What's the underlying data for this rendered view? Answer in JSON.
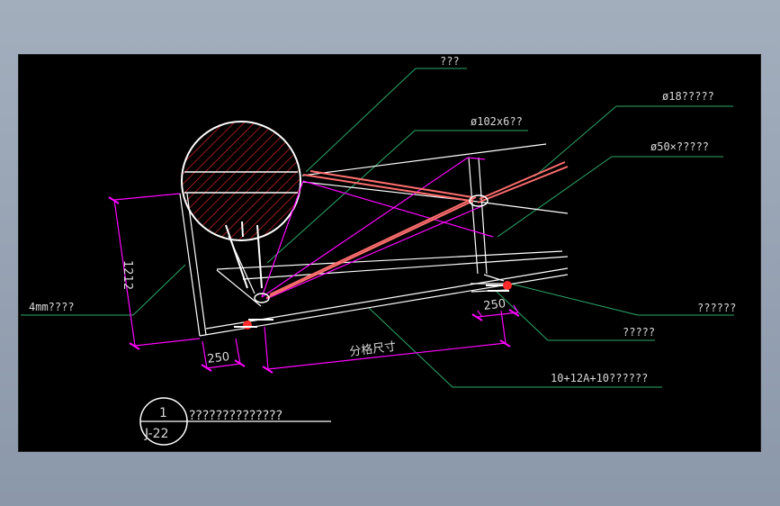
{
  "drawing": {
    "labels": {
      "top_label": "???",
      "rod_label": "ø18?????",
      "tube_label": "ø102x6??",
      "cable_label": "ø50×?????",
      "left_label": "4mm????",
      "right_top_label": "??????",
      "right_mid_label": "?????",
      "glass_label": "10+12A+10??????"
    },
    "dimensions": {
      "height": "1212",
      "left_offset": "250",
      "right_offset": "250",
      "grid_size": "分格尺寸"
    },
    "title_block": {
      "detail_number": "1",
      "sheet_ref": "J-22",
      "title": "??????????????"
    },
    "colors": {
      "background": "#000000",
      "window_bg": "#95a1b3",
      "white_line": "#ffffff",
      "magenta_line": "#ff00ff",
      "red_hatch": "#ff2a2a",
      "leader_line": "#2ba96a",
      "text": "#d9d9d9"
    }
  }
}
